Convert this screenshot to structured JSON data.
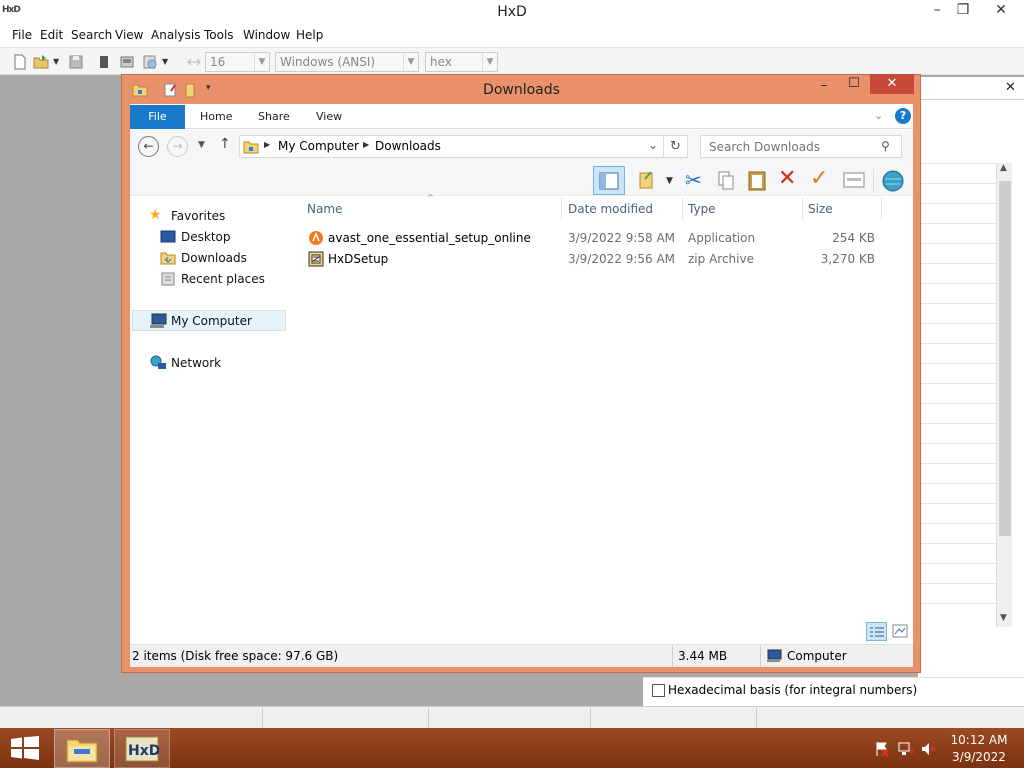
{
  "hxd": {
    "title": "HxD",
    "menu": [
      "File",
      "Edit",
      "Search",
      "View",
      "Analysis",
      "Tools",
      "Window",
      "Help"
    ],
    "toolbar": {
      "bytes_per_row": "16",
      "charset": "Windows (ANSI)",
      "offset_base": "hex"
    },
    "hex_checkbox_label": "Hexadecimal basis (for integral numbers)",
    "close_glyph": "✕"
  },
  "explorer": {
    "title": "Downloads",
    "ribbon_tabs": [
      "File",
      "Home",
      "Share",
      "View"
    ],
    "breadcrumb": [
      "My Computer",
      "Downloads"
    ],
    "search_placeholder": "Search Downloads",
    "nav": {
      "favorites": "Favorites",
      "desktop": "Desktop",
      "downloads": "Downloads",
      "recent": "Recent places",
      "computer": "My Computer",
      "network": "Network"
    },
    "columns": [
      "Name",
      "Date modified",
      "Type",
      "Size"
    ],
    "files": [
      {
        "name": "avast_one_essential_setup_online",
        "date": "3/9/2022 9:58 AM",
        "type": "Application",
        "size": "254 KB"
      },
      {
        "name": "HxDSetup",
        "date": "3/9/2022 9:56 AM",
        "type": "zip Archive",
        "size": "3,270 KB"
      }
    ],
    "status": {
      "items": "2 items (Disk free space: 97.6 GB)",
      "size": "3.44 MB",
      "location": "Computer"
    }
  },
  "taskbar": {
    "time": "10:12 AM",
    "date": "3/9/2022"
  },
  "colors": {
    "explorer_frame": "#e8916a",
    "file_tab": "#1979ca",
    "taskbar": "#8a3a12"
  }
}
